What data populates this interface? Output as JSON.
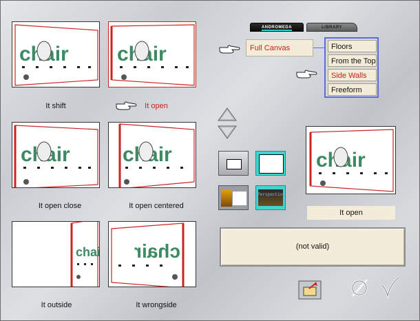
{
  "tabs": {
    "andromeda": "ANDROMEDA",
    "library": "LIBRARY"
  },
  "canvas_mode": "Full Canvas",
  "menu": {
    "items": [
      "Floors",
      "From the Top",
      "Side Walls",
      "Freeform"
    ],
    "selected": "Side Walls"
  },
  "thumbnails": [
    {
      "caption": "It shift"
    },
    {
      "caption": "It open"
    },
    {
      "caption": "It open close"
    },
    {
      "caption": "It open centered"
    },
    {
      "caption": "It outside"
    },
    {
      "caption": "It wrongside"
    }
  ],
  "thumb_word": "chair",
  "preview_label": "It open",
  "status_text": "(not valid)",
  "perspective_label": "Perspective",
  "colors": {
    "accent_red": "#c8201e",
    "menu_border": "#5d6ad8",
    "chair_green": "#3c8a63",
    "panel_bg": "#f2ecd9"
  }
}
